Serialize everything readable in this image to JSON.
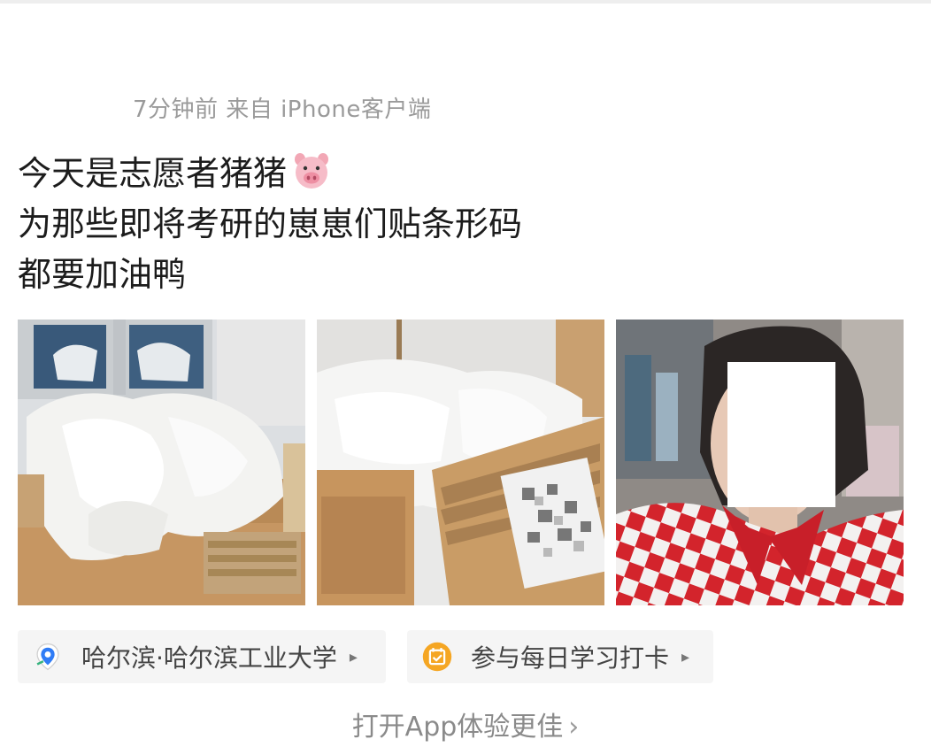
{
  "post": {
    "meta": "7分钟前 来自 iPhone客户端",
    "lines": [
      "今天是志愿者猪猪",
      "为那些即将考研的崽崽们贴条形码",
      "都要加油鸭"
    ],
    "emoji": "pig-face"
  },
  "photos": [
    {
      "name": "photo-paper-pile-table"
    },
    {
      "name": "photo-envelopes-paper-floor"
    },
    {
      "name": "photo-selfie-red-checkered"
    }
  ],
  "location": {
    "label": "哈尔滨·哈尔滨工业大学",
    "icon": "map-pin-icon",
    "color": "#2f7cf6"
  },
  "activity": {
    "label": "参与每日学习打卡",
    "icon": "calendar-check-icon",
    "color": "#f5a623"
  },
  "footer": {
    "open_app_label": "打开App体验更佳",
    "chevron": "›"
  }
}
